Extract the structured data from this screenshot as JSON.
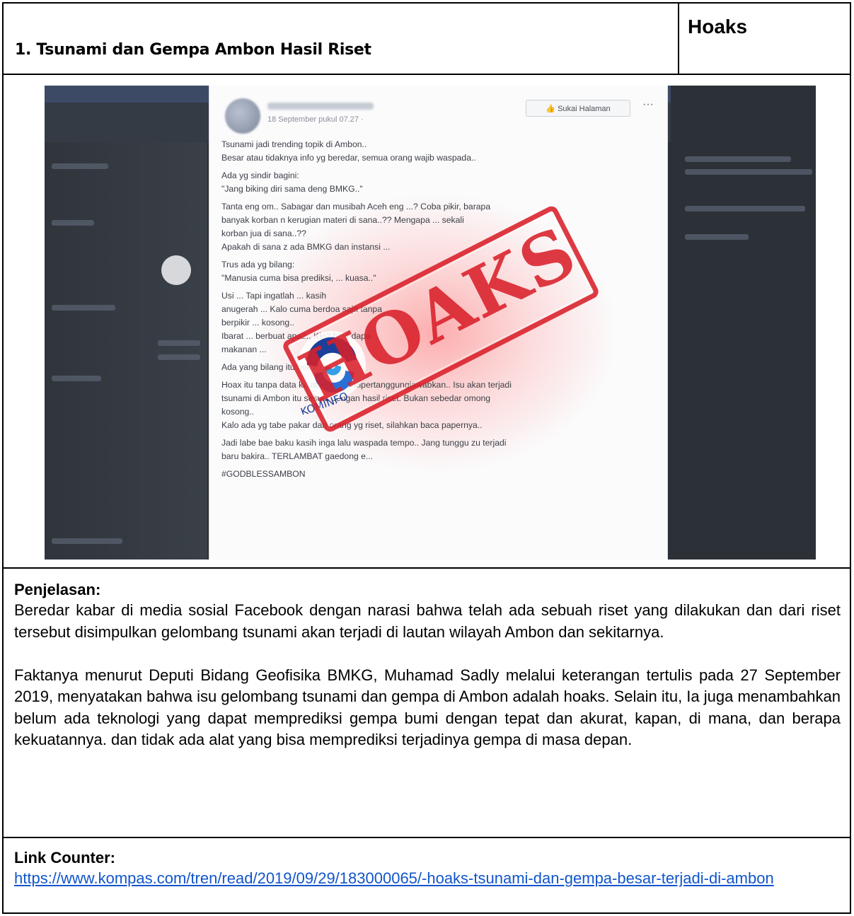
{
  "header": {
    "title": "1. Tsunami dan Gempa Ambon Hasil Riset",
    "label": "Hoaks"
  },
  "screenshot": {
    "date": "18 September pukul 07.27 · ",
    "follow_button": "Sukai Halaman",
    "more_glyph": "···",
    "paragraphs": [
      "Tsunami jadi trending topik di Ambon..\nBesar atau tidaknya info yg beredar, semua orang wajib waspada..",
      "Ada yg sindir bagini:\n\"Jang biking diri sama deng BMKG..\"",
      "Tanta eng om.. Sabagar dan musibah Aceh eng ...? Coba pikir, barapa\nbanyak korban n kerugian materi di sana..?? Mengapa ... sekali\nkorban jua di sana..??\nApakah di sana z ada BMKG dan instansi ...",
      "Trus ada yg bilang:\n\"Manusia cuma bisa prediksi, ... kuasa..\"",
      "Usi ... Tapi ingatlah ... kasih\nanugerah ... Kalo cuma berdoa saja tanpa\nberpikir ... kosong..\nIbarat ... berbuat apa2.. Kin2 bisa dapa\nmakanan ...",
      "Ada yang bilang itu hoax..",
      "Hoax itu tanpa data kb atau z bisa dipertanggungjawabkan.. Isu akan terjadi\ntsunami di Ambon itu sesuai dengan hasil riset. Bukan sebedar omong\nkosong..\nKalo ada yg tabe pakar dari orang yg riset, silahkan baca papernya..",
      "Jadi labe bae baku kasih inga lalu waspada tempo.. Jang tunggu zu terjadi\nbaru bakira.. TERLAMBAT gaedong e...",
      "#GODBLESSAMBON"
    ],
    "stamp": "HOAKS",
    "watermark": "KOMINFO"
  },
  "explanation": {
    "heading": "Penjelasan:",
    "paragraph1": "Beredar kabar di media sosial Facebook dengan narasi bahwa telah ada sebuah riset yang dilakukan dan dari riset tersebut disimpulkan gelombang tsunami akan terjadi di lautan wilayah Ambon dan sekitarnya.",
    "paragraph2": "Faktanya menurut Deputi Bidang Geofisika BMKG, Muhamad Sadly melalui keterangan tertulis pada 27 September 2019, menyatakan bahwa isu gelombang tsunami dan gempa di Ambon adalah hoaks. Selain itu, Ia juga menambahkan belum ada teknologi yang dapat memprediksi gempa bumi dengan tepat dan akurat, kapan, di mana, dan berapa kekuatannya. dan tidak ada alat yang bisa memprediksi terjadinya gempa di masa depan."
  },
  "link_counter": {
    "heading": "Link Counter:",
    "url": "https://www.kompas.com/tren/read/2019/09/29/183000065/-hoaks-tsunami-dan-gempa-besar-terjadi-di-ambon"
  },
  "colors": {
    "stamp_red": "#d9202a",
    "link_blue": "#1155cc",
    "kominfo_blue": "#1b3f9a"
  }
}
